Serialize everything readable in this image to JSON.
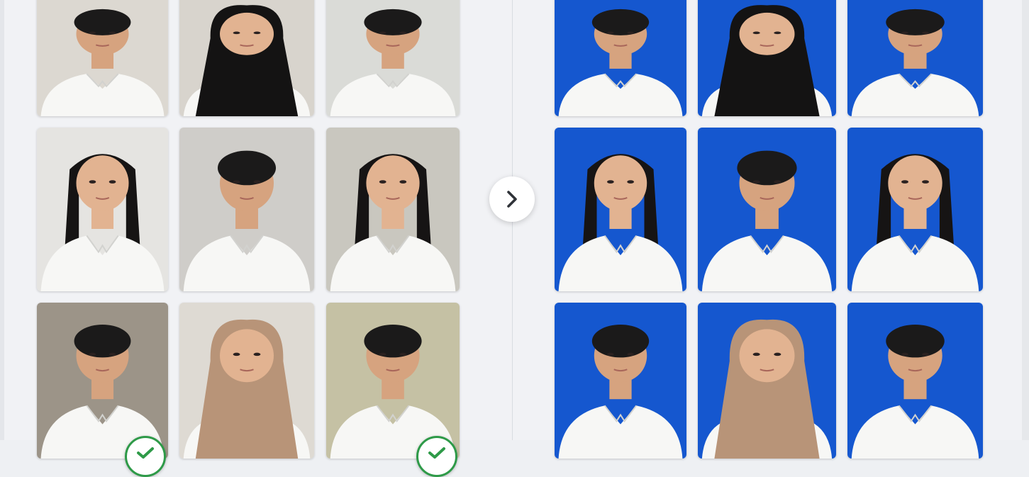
{
  "colors": {
    "replacement_background": "#1557cf",
    "check_green": "#2e9a48"
  },
  "icons": {
    "next": "chevron-right-icon",
    "selected": "checkmark-icon"
  },
  "before_photos": [
    {
      "subject": "man",
      "hair": "short",
      "background": "#dcd8d1",
      "selected": false
    },
    {
      "subject": "woman",
      "hair": "black-hijab",
      "background": "#d8d4cd",
      "selected": false
    },
    {
      "subject": "man",
      "hair": "short",
      "background": "#dadbd7",
      "selected": false
    },
    {
      "subject": "woman",
      "hair": "long",
      "background": "#e5e4e1",
      "selected": false
    },
    {
      "subject": "man",
      "hair": "short",
      "background": "#cfcdc9",
      "selected": false
    },
    {
      "subject": "woman",
      "hair": "long",
      "background": "#c9c7bf",
      "selected": false
    },
    {
      "subject": "man",
      "hair": "short",
      "background": "#9c9488",
      "selected": true
    },
    {
      "subject": "woman",
      "hair": "tan-hijab",
      "background": "#dedad3",
      "selected": false
    },
    {
      "subject": "man",
      "hair": "short",
      "background": "#c5c1a4",
      "selected": true
    }
  ],
  "after_photos": [
    {
      "subject": "man",
      "hair": "short"
    },
    {
      "subject": "woman",
      "hair": "black-hijab"
    },
    {
      "subject": "man",
      "hair": "short"
    },
    {
      "subject": "woman",
      "hair": "long"
    },
    {
      "subject": "man",
      "hair": "short"
    },
    {
      "subject": "woman",
      "hair": "long"
    },
    {
      "subject": "man",
      "hair": "short"
    },
    {
      "subject": "woman",
      "hair": "tan-hijab"
    },
    {
      "subject": "man",
      "hair": "short"
    }
  ]
}
